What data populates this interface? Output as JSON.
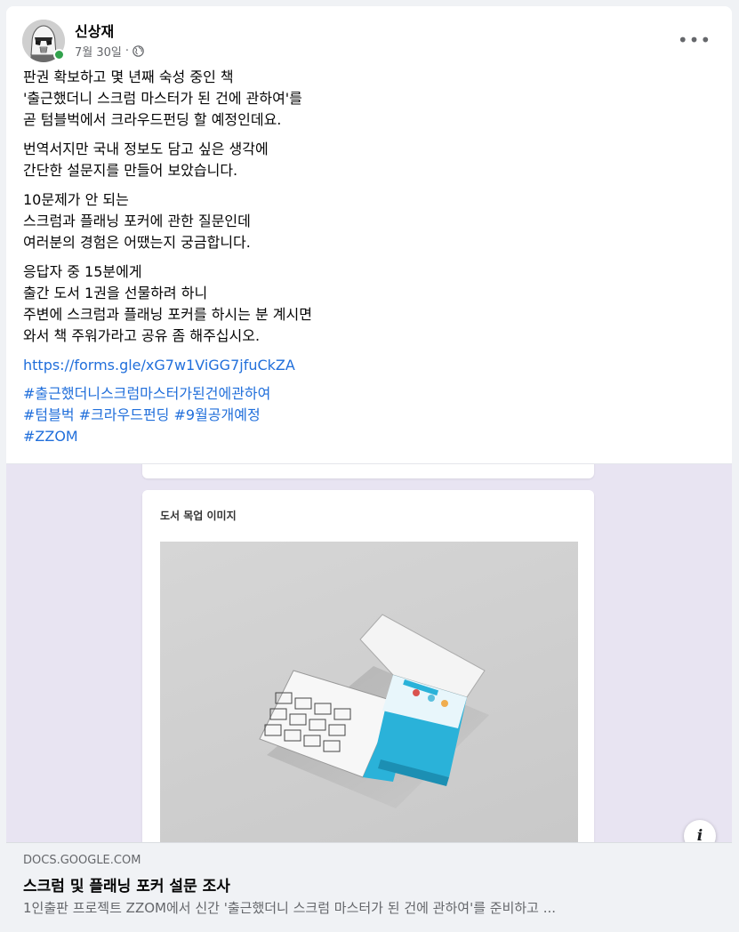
{
  "post": {
    "author": "신상재",
    "date": "7월 30일",
    "separator": "·",
    "privacy_icon": "globe-icon",
    "more_icon": "more-dots-icon",
    "more_label": "•••",
    "paragraphs": [
      [
        "판권 확보하고 몇 년째 숙성 중인 책",
        "'출근했더니 스크럼 마스터가 된 건에 관하여'를",
        "곧 텀블벅에서 크라우드펀딩 할 예정인데요."
      ],
      [
        "번역서지만 국내 정보도 담고 싶은 생각에",
        "간단한 설문지를 만들어 보았습니다."
      ],
      [
        "10문제가 안 되는",
        "스크럼과 플래닝 포커에 관한 질문인데",
        "여러분의 경험은 어땠는지 궁금합니다."
      ],
      [
        "응답자 중 15분에게",
        "출간 도서 1권을 선물하려 하니",
        "주변에 스크럼과 플래닝 포커를 하시는 분 계시면",
        "와서 책 주워가라고 공유 좀 해주십시오."
      ]
    ],
    "url": "https://forms.gle/xG7w1ViGG7jfuCkZA",
    "hashtags": [
      [
        "#출근했더니스크럼마스터가된건에관하여"
      ],
      [
        "#텀블벅",
        "#크라우드펀딩",
        "#9월공개예정"
      ],
      [
        "#ZZOM"
      ]
    ]
  },
  "preview": {
    "card_title": "도서 목업 이미지",
    "info_label": "i"
  },
  "link": {
    "domain": "DOCS.GOOGLE.COM",
    "title": "스크럼 및 플래닝 포커 설문 조사",
    "description": "1인출판 프로젝트 ZZOM에서 신간 '출근했더니 스크럼 마스터가 된 건에 관하여'를 준비하고 ..."
  },
  "colors": {
    "link_blue": "#216fdb",
    "online_green": "#31a24c",
    "meta_gray": "#65676b",
    "book_cyan": "#2ab2d9"
  }
}
